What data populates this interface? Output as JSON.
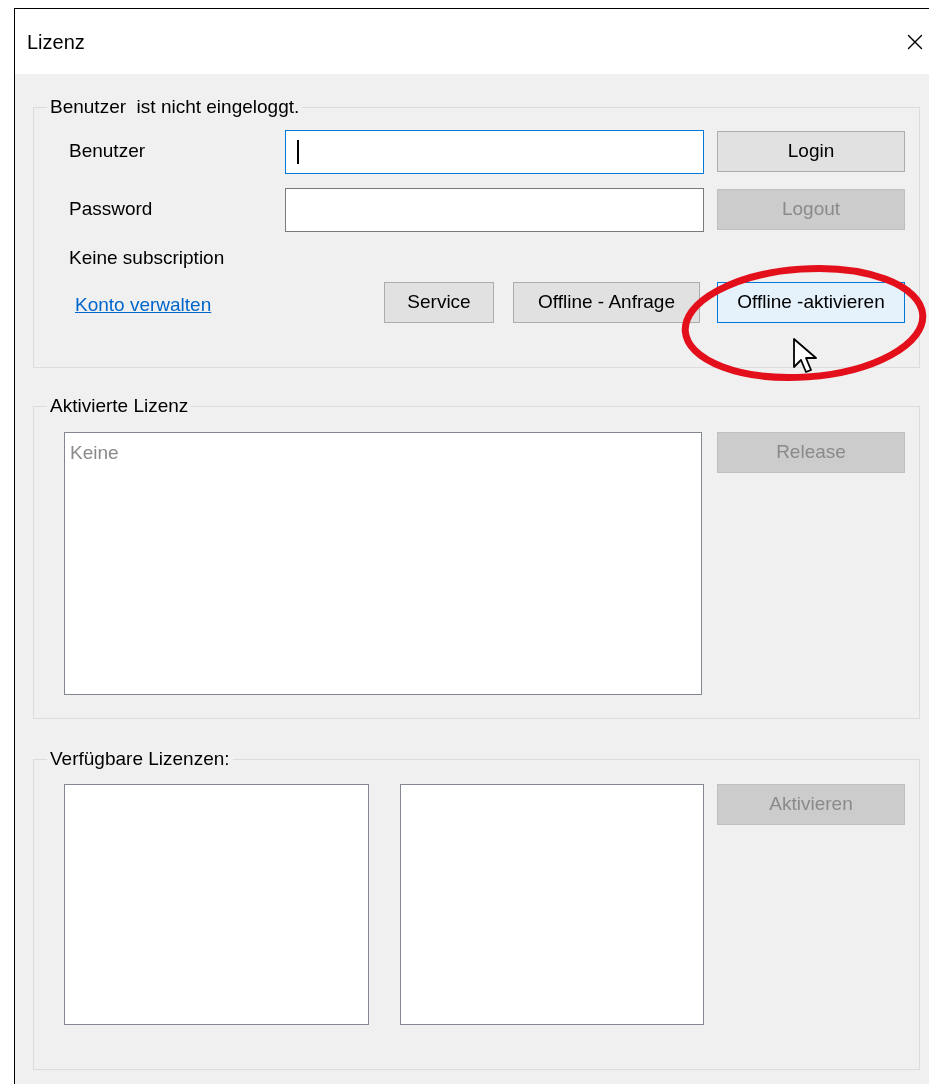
{
  "window": {
    "title": "Lizenz"
  },
  "login_group": {
    "legend": "Benutzer  ist nicht eingeloggt.",
    "fields": [
      {
        "label": "Benutzer",
        "focused": true
      },
      {
        "label": "Password",
        "focused": false
      }
    ],
    "buttons": [
      {
        "label": "Login",
        "disabled": false
      },
      {
        "label": "Logout",
        "disabled": true
      }
    ],
    "subscription_status": "Keine subscription",
    "link": "Konto verwalten",
    "actions": [
      {
        "label": "Service",
        "highlighted": false
      },
      {
        "label": "Offline - Anfrage",
        "highlighted": false
      },
      {
        "label": "Offline -aktivieren",
        "highlighted": true
      }
    ]
  },
  "activated_group": {
    "legend": "Aktivierte Lizenz",
    "items": [
      {
        "text": "Keine",
        "disabled": true
      }
    ],
    "button": {
      "label": "Release",
      "disabled": true
    }
  },
  "available_group": {
    "legend": "Verfügbare Lizenzen:",
    "button": {
      "label": "Aktivieren",
      "disabled": true
    }
  }
}
